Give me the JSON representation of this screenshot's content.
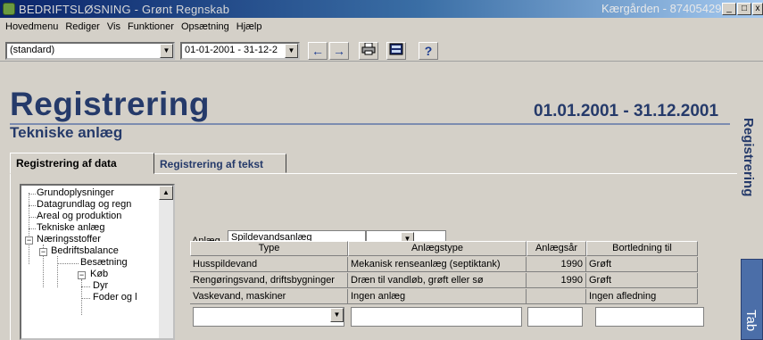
{
  "window": {
    "title": "BEDRIFTSLØSNING - Grønt Regnskab",
    "title_right": "Kærgården - 87405429",
    "minimize": "_",
    "maximize": "□",
    "close": "x"
  },
  "menu": [
    "Hovedmenu",
    "Rediger",
    "Vis",
    "Funktioner",
    "Opsætning",
    "Hjælp"
  ],
  "toolbar": {
    "profile_value": "(standard)",
    "period_value": "01-01-2001 - 31-12-2"
  },
  "page": {
    "title": "Registrering",
    "date_range": "01.01.2001 - 31.12.2001",
    "subtitle": "Tekniske anlæg",
    "side_label": "Registrering",
    "side_tab": "Tab"
  },
  "tabs": [
    {
      "label": "Registrering af data",
      "active": true
    },
    {
      "label": "Registrering af tekst",
      "active": false
    }
  ],
  "tree": [
    {
      "label": "Grundoplysninger",
      "level": 0
    },
    {
      "label": "Datagrundlag og regn",
      "level": 0
    },
    {
      "label": "Areal og produktion",
      "level": 0
    },
    {
      "label": "Tekniske anlæg",
      "level": 0
    },
    {
      "label": "Næringsstoffer",
      "level": 0,
      "expander": "−"
    },
    {
      "label": "Bedriftsbalance",
      "level": 1,
      "expander": "−"
    },
    {
      "label": "Besætning",
      "level": 2
    },
    {
      "label": "Køb",
      "level": 2,
      "expander": "−"
    },
    {
      "label": "Dyr",
      "level": 3
    },
    {
      "label": "Foder og l",
      "level": 3
    }
  ],
  "anlaeg": {
    "label": "Anlæg",
    "value": "Spildevandsanlæg"
  },
  "grid": {
    "headers": [
      "Type",
      "Anlægstype",
      "Anlægsår",
      "Bortledning til"
    ],
    "rows": [
      [
        "Husspildevand",
        "Mekanisk renseanlæg (septiktank)",
        "1990",
        "Grøft"
      ],
      [
        "Rengøringsvand, driftsbygninger",
        "Dræn til vandløb, grøft eller sø",
        "1990",
        "Grøft"
      ],
      [
        "Vaskevand, maskiner",
        "Ingen anlæg",
        "",
        "Ingen afledning"
      ]
    ]
  },
  "colors": {
    "heading": "#253a6a",
    "title_bar_start": "#0a246a",
    "side_tab": "#4b6ea8"
  }
}
